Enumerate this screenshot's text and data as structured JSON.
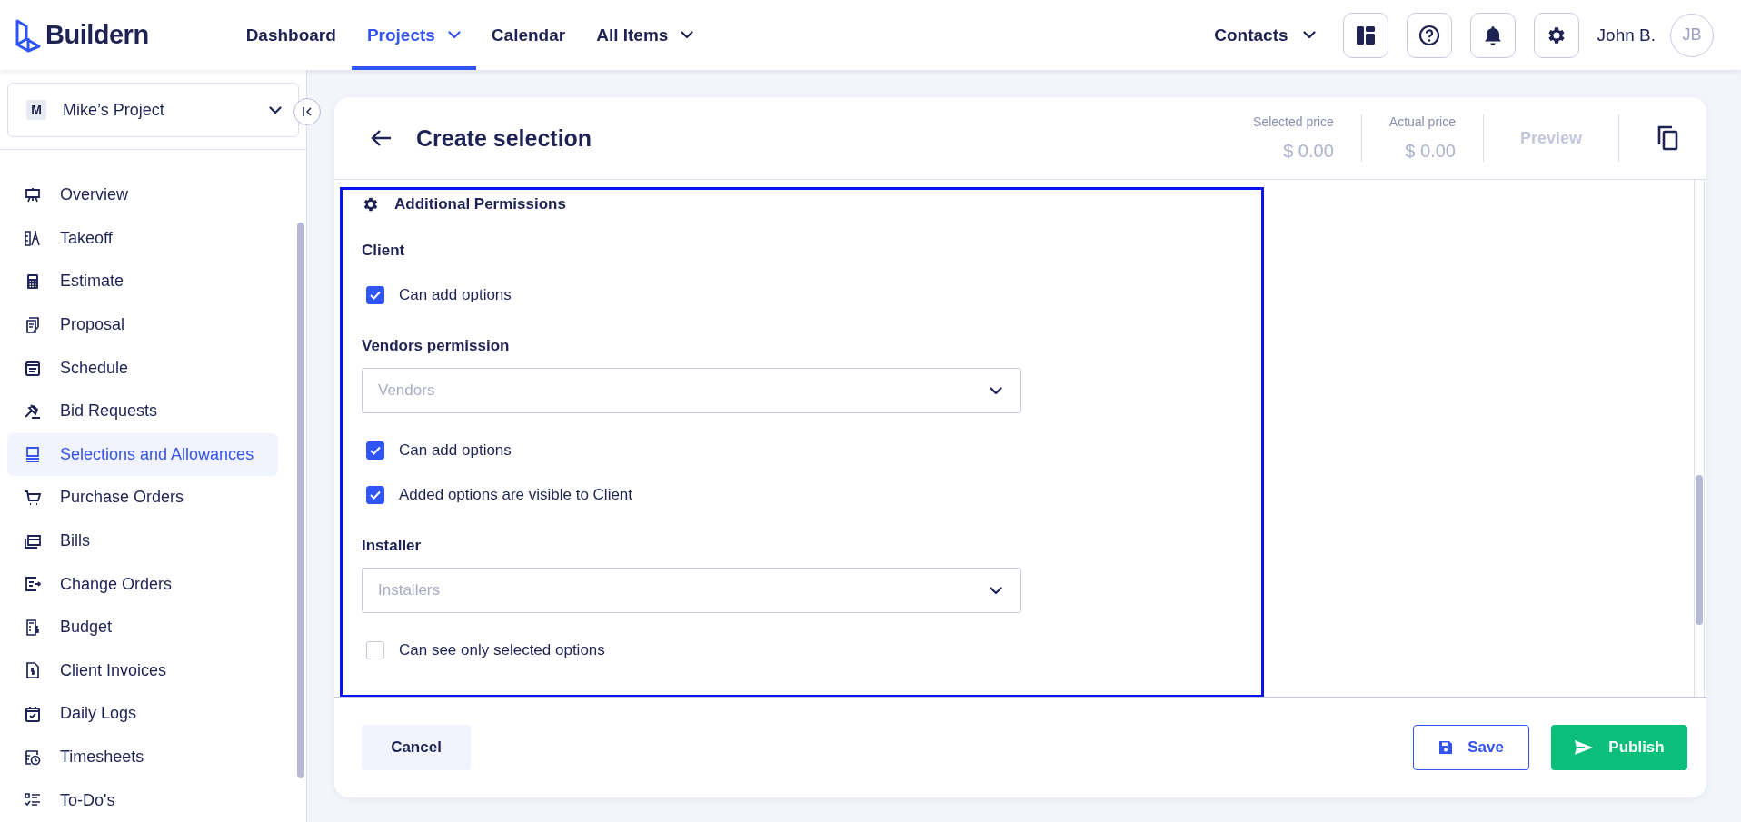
{
  "brand": {
    "name": "Buildern"
  },
  "nav": [
    {
      "label": "Dashboard",
      "selected": false,
      "dropdown": false
    },
    {
      "label": "Projects",
      "selected": true,
      "dropdown": true
    },
    {
      "label": "Calendar",
      "selected": false,
      "dropdown": false
    },
    {
      "label": "All Items",
      "selected": false,
      "dropdown": true
    }
  ],
  "contacts": {
    "label": "Contacts"
  },
  "user": {
    "name": "John B.",
    "initials": "JB"
  },
  "project_select": {
    "badge": "M",
    "value": "Mike’s Project"
  },
  "sidebar": {
    "items": [
      {
        "label": "Overview",
        "selected": false
      },
      {
        "label": "Takeoff",
        "selected": false
      },
      {
        "label": "Estimate",
        "selected": false
      },
      {
        "label": "Proposal",
        "selected": false
      },
      {
        "label": "Schedule",
        "selected": false
      },
      {
        "label": "Bid Requests",
        "selected": false
      },
      {
        "label": "Selections and Allowances",
        "selected": true
      },
      {
        "label": "Purchase Orders",
        "selected": false
      },
      {
        "label": "Bills",
        "selected": false
      },
      {
        "label": "Change Orders",
        "selected": false
      },
      {
        "label": "Budget",
        "selected": false
      },
      {
        "label": "Client Invoices",
        "selected": false
      },
      {
        "label": "Daily Logs",
        "selected": false
      },
      {
        "label": "Timesheets",
        "selected": false
      },
      {
        "label": "To-Do's",
        "selected": false
      }
    ]
  },
  "page": {
    "title": "Create selection",
    "prices": [
      {
        "label": "Selected price",
        "value": "$ 0.00"
      },
      {
        "label": "Actual price",
        "value": "$ 0.00"
      }
    ],
    "preview": {
      "label": "Preview",
      "disabled": true
    }
  },
  "permissions": {
    "title": "Additional Permissions",
    "sections": [
      {
        "heading": "Client",
        "checkboxes": [
          {
            "label": "Can add options",
            "checked": true
          }
        ]
      },
      {
        "heading": "Vendors permission",
        "dropdown": {
          "placeholder": "Vendors"
        },
        "checkboxes": [
          {
            "label": "Can add options",
            "checked": true
          },
          {
            "label": "Added options are visible to Client",
            "checked": true
          }
        ]
      },
      {
        "heading": "Installer",
        "dropdown": {
          "placeholder": "Installers"
        },
        "checkboxes": [
          {
            "label": "Can see only selected options",
            "checked": false
          }
        ]
      }
    ]
  },
  "footer": {
    "cancel": "Cancel",
    "save": "Save",
    "publish": "Publish"
  }
}
